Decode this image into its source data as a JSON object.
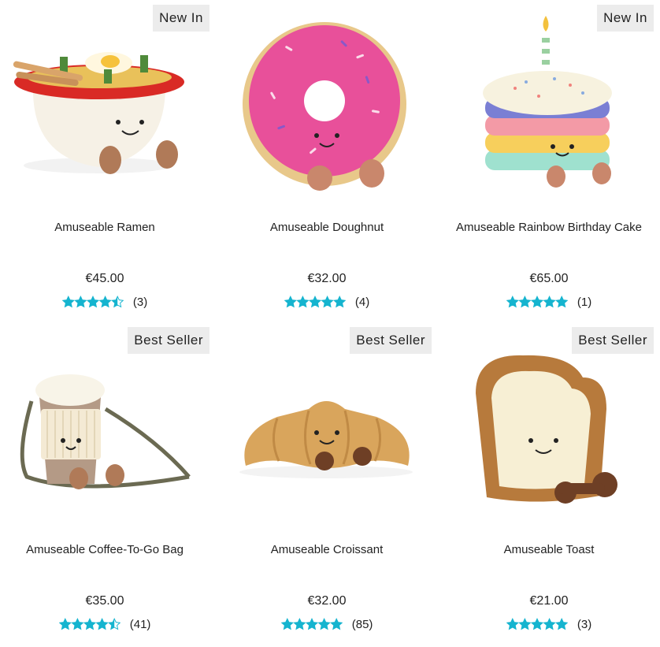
{
  "products": [
    {
      "name": "Amuseable Ramen",
      "price": "€45.00",
      "badge": "New In",
      "rating": 4.5,
      "review_count": "(3)",
      "image_icon": "ramen-plush-image"
    },
    {
      "name": "Amuseable Doughnut",
      "price": "€32.00",
      "badge": "",
      "rating": 5,
      "review_count": "(4)",
      "image_icon": "doughnut-plush-image"
    },
    {
      "name": "Amuseable Rainbow Birthday Cake",
      "price": "€65.00",
      "badge": "New In",
      "rating": 5,
      "review_count": "(1)",
      "image_icon": "birthday-cake-plush-image"
    },
    {
      "name": "Amuseable Coffee-To-Go Bag",
      "price": "€35.00",
      "badge": "Best Seller",
      "rating": 4.5,
      "review_count": "(41)",
      "image_icon": "coffee-bag-plush-image"
    },
    {
      "name": "Amuseable Croissant",
      "price": "€32.00",
      "badge": "Best Seller",
      "rating": 5,
      "review_count": "(85)",
      "image_icon": "croissant-plush-image"
    },
    {
      "name": "Amuseable Toast",
      "price": "€21.00",
      "badge": "Best Seller",
      "rating": 5,
      "review_count": "(3)",
      "image_icon": "toast-plush-image"
    }
  ],
  "colors": {
    "star": "#15b4cf",
    "badge_bg": "#ececec",
    "text": "#222222"
  }
}
